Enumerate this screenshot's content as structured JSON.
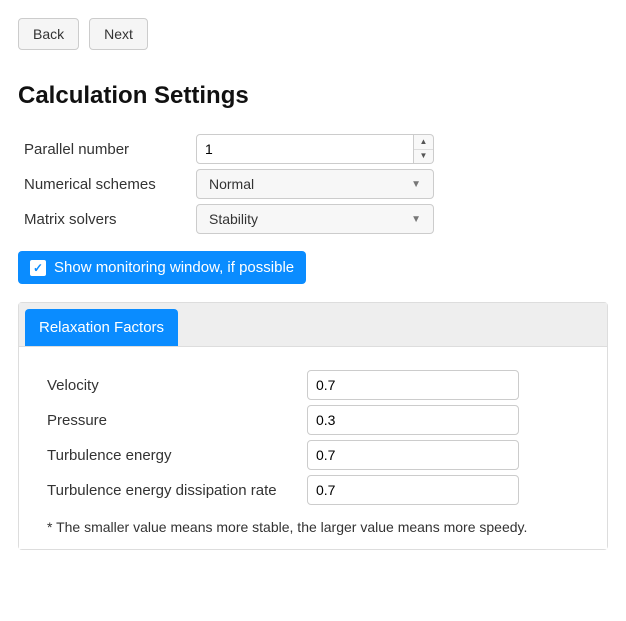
{
  "nav": {
    "back": "Back",
    "next": "Next"
  },
  "title": "Calculation Settings",
  "form": {
    "parallel_label": "Parallel number",
    "parallel_value": "1",
    "schemes_label": "Numerical schemes",
    "schemes_value": "Normal",
    "solvers_label": "Matrix solvers",
    "solvers_value": "Stability"
  },
  "monitoring": {
    "label": "Show monitoring window, if possible",
    "checked": true
  },
  "tabs": {
    "relaxation": "Relaxation Factors"
  },
  "relaxation": {
    "velocity_label": "Velocity",
    "velocity_value": "0.7",
    "pressure_label": "Pressure",
    "pressure_value": "0.3",
    "turb_energy_label": "Turbulence energy",
    "turb_energy_value": "0.7",
    "turb_diss_label": "Turbulence energy dissipation rate",
    "turb_diss_value": "0.7",
    "note": "* The smaller value means more stable, the larger value means more speedy."
  }
}
